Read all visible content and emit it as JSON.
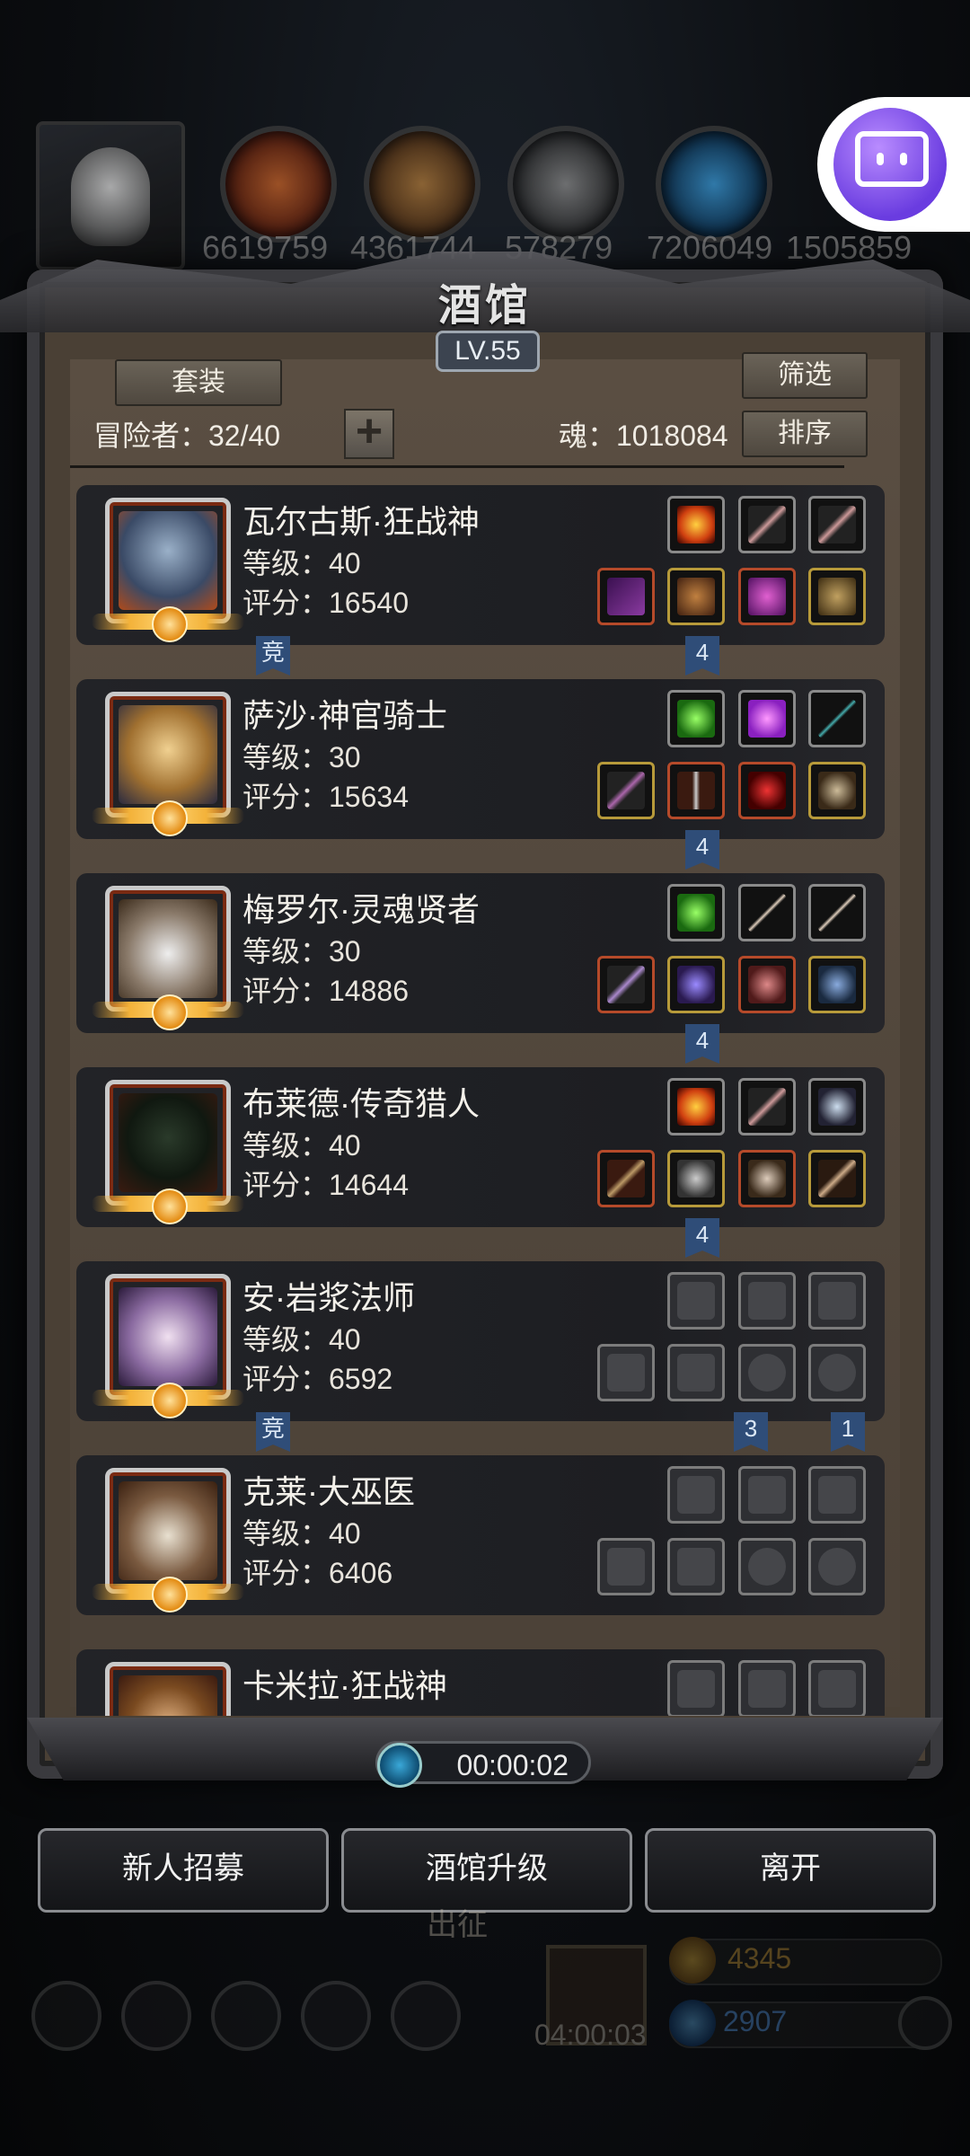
{
  "top_strip": {
    "resource_values": [
      "6619759",
      "4361744",
      "578279",
      "7206049",
      "1505859"
    ]
  },
  "panel": {
    "title": "酒馆",
    "level": "LV.55",
    "set_button": "套装",
    "filter_button": "筛选",
    "sort_button": "排序",
    "adventurers_label": "冒险者：32/40",
    "add_button": "+",
    "soul_label": "魂：1018084"
  },
  "heroes": [
    {
      "name": "瓦尔古斯·狂战神",
      "level": "等级：40",
      "score": "评分：16540",
      "tag_left": "竞",
      "tag_mid": "4",
      "tag_right": ""
    },
    {
      "name": "萨沙·神官骑士",
      "level": "等级：30",
      "score": "评分：15634",
      "tag_left": "",
      "tag_mid": "4",
      "tag_right": ""
    },
    {
      "name": "梅罗尔·灵魂贤者",
      "level": "等级：30",
      "score": "评分：14886",
      "tag_left": "",
      "tag_mid": "4",
      "tag_right": ""
    },
    {
      "name": "布莱德·传奇猎人",
      "level": "等级：40",
      "score": "评分：14644",
      "tag_left": "",
      "tag_mid": "4",
      "tag_right": ""
    },
    {
      "name": "安·岩浆法师",
      "level": "等级：40",
      "score": "评分：6592",
      "tag_left": "竞",
      "tag_mid": "3",
      "tag_right": "1"
    },
    {
      "name": "克莱·大巫医",
      "level": "等级：40",
      "score": "评分：6406",
      "tag_left": "",
      "tag_mid": "",
      "tag_right": ""
    },
    {
      "name": "卡米拉·狂战神",
      "level": "",
      "score": "",
      "tag_left": "",
      "tag_mid": "",
      "tag_right": ""
    }
  ],
  "timer": "00:00:02",
  "bottom_buttons": {
    "recruit": "新人招募",
    "upgrade": "酒馆升级",
    "leave": "离开"
  },
  "background_hud": {
    "expedition": "出征",
    "gift_timer": "04:00:03",
    "gold": "4345",
    "gems": "2907"
  },
  "colors": {
    "panel_bg": "#4a4035",
    "row_bg": "#1e1f23",
    "tag_blue": "#2f4d78",
    "gold_border": "#b79a3a"
  }
}
